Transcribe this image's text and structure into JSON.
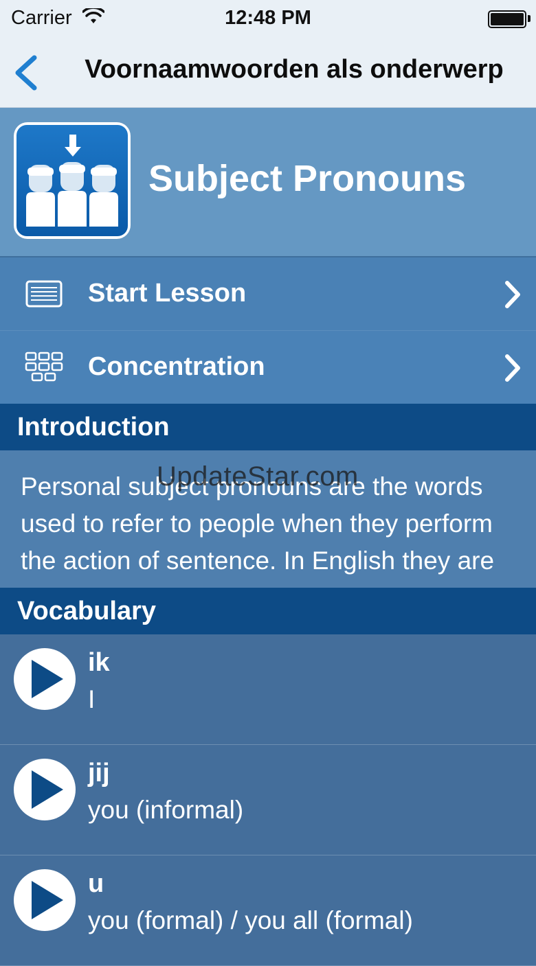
{
  "status_bar": {
    "carrier": "Carrier",
    "time": "12:48 PM"
  },
  "nav": {
    "title": "Voornaamwoorden als onderwerp"
  },
  "lesson": {
    "title": "Subject Pronouns"
  },
  "menu": [
    {
      "label": "Start Lesson",
      "icon": "lesson-list-icon"
    },
    {
      "label": "Concentration",
      "icon": "grid-icon"
    }
  ],
  "introduction": {
    "header": "Introduction",
    "text": "Personal subject pronouns are the words used to refer to people when they perform the action of sentence. In English they are words like \"I\", \"you\""
  },
  "watermark": "UpdateStar.com",
  "vocabulary": {
    "header": "Vocabulary",
    "items": [
      {
        "term": "ik",
        "meaning": "I"
      },
      {
        "term": "jij",
        "meaning": "you (informal)"
      },
      {
        "term": "u",
        "meaning": "you (formal) / you all (formal)"
      }
    ]
  },
  "colors": {
    "nav_background": "#e9f0f6",
    "accent": "#1f7fd0",
    "section_header": "#0d4b86",
    "hero_background": "#6598c3"
  }
}
